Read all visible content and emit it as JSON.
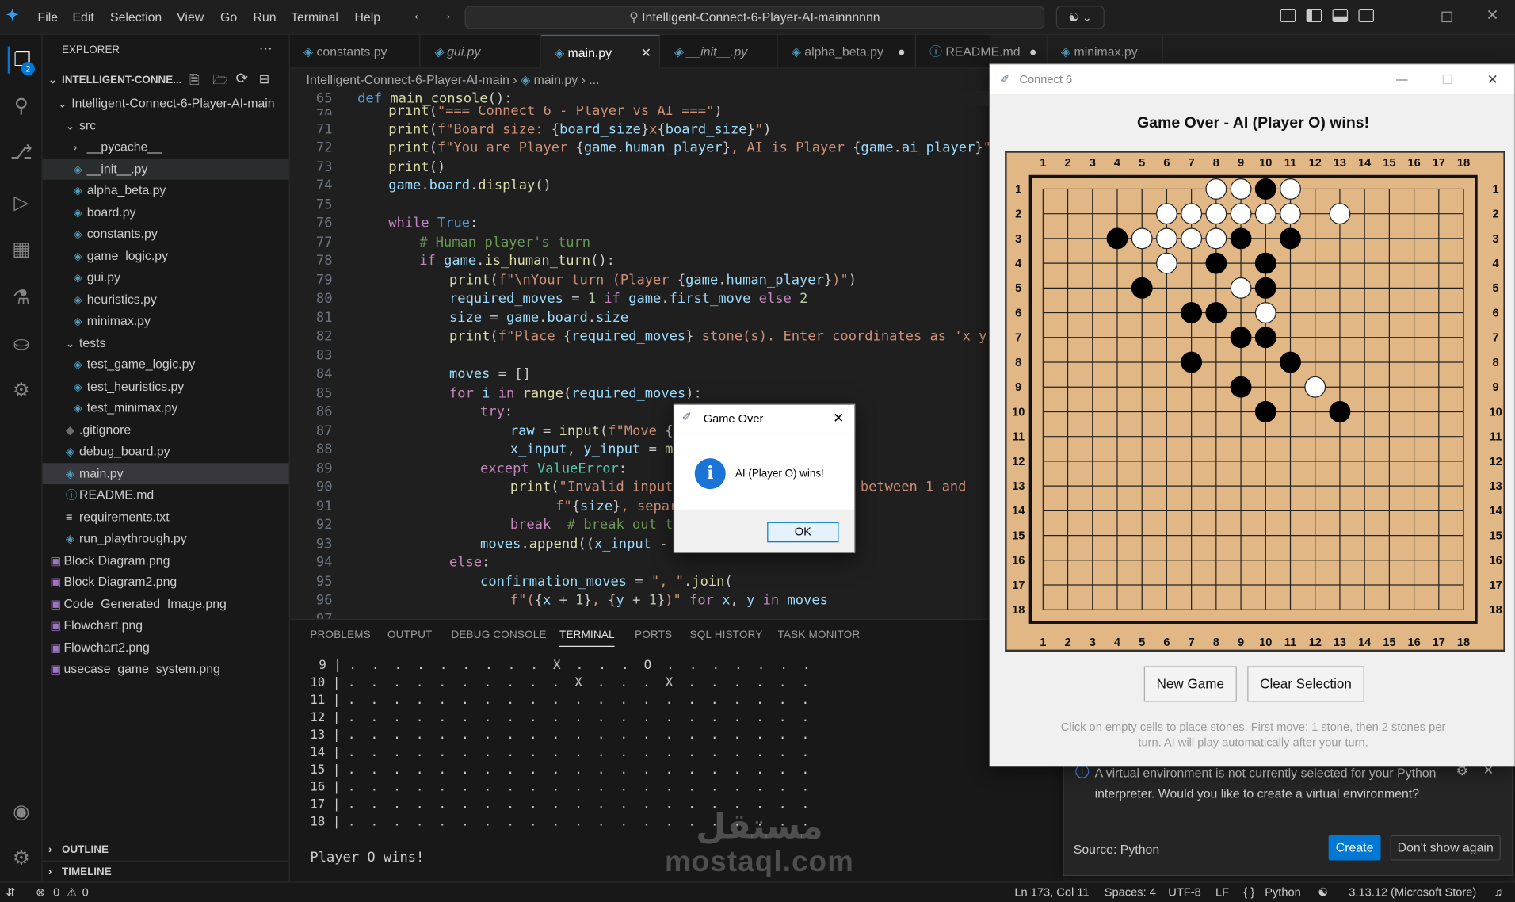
{
  "menu": [
    "File",
    "Edit",
    "Selection",
    "View",
    "Go",
    "Run",
    "Terminal",
    "Help"
  ],
  "command_center": "Intelligent-Connect-6-Player-AI-mainnnnnn",
  "explorer": {
    "title": "EXPLORER",
    "root": "INTELLIGENT-CONNE...",
    "items": [
      "Intelligent-Connect-6-Player-AI-main",
      "src",
      "__pycache__",
      "__init__.py",
      "alpha_beta.py",
      "board.py",
      "constants.py",
      "game_logic.py",
      "gui.py",
      "heuristics.py",
      "minimax.py",
      "tests",
      "test_game_logic.py",
      "test_heuristics.py",
      "test_minimax.py",
      ".gitignore",
      "debug_board.py",
      "main.py",
      "README.md",
      "requirements.txt",
      "run_playthrough.py",
      "Block Diagram.png",
      "Block Diagram2.png",
      "Code_Generated_Image.png",
      "Flowchart.png",
      "Flowchart2.png",
      "usecase_game_system.png"
    ],
    "outline": "OUTLINE",
    "timeline": "TIMELINE"
  },
  "tabs": [
    "constants.py",
    "gui.py",
    "main.py",
    "__init__.py",
    "alpha_beta.py",
    "README.md",
    "minimax.py"
  ],
  "breadcrumb": {
    "folder": "Intelligent-Connect-6-Player-AI-main",
    "file": "main.py",
    "rest": "..."
  },
  "code": {
    "line_numbers": [
      "65",
      "70",
      "71",
      "72",
      "73",
      "74",
      "75",
      "76",
      "77",
      "78",
      "79",
      "80",
      "81",
      "82",
      "83",
      "84",
      "85",
      "86",
      "87",
      "88",
      "89",
      "90",
      "91",
      "92",
      "93",
      "94",
      "95",
      "96",
      "97"
    ]
  },
  "panel": {
    "tabs": [
      "PROBLEMS",
      "OUTPUT",
      "DEBUG CONSOLE",
      "TERMINAL",
      "PORTS",
      "SQL HISTORY",
      "TASK MONITOR"
    ],
    "lines": [
      " 9 | .  .  .  .  .  .  .  .  .  X  .  .  .  O  .  .  .  .  .  .  .",
      " 10 | .  .  .  .  .  .  .  .  .  .  X  .  .  .  X  .  .  .  .  .  .",
      " 11 | .  .  .  .  .  .  .  .  .  .  .  .  .  .  .  .  .  .  .  .  .",
      " 12 | .  .  .  .  .  .  .  .  .  .  .  .  .  .  .  .  .  .  .  .  .",
      " 13 | .  .  .  .  .  .  .  .  .  .  .  .  .  .  .  .  .  .  .  .  .",
      " 14 | .  .  .  .  .  .  .  .  .  .  .  .  .  .  .  .  .  .  .  .  .",
      " 15 | .  .  .  .  .  .  .  .  .  .  .  .  .  .  .  .  .  .  .  .  .",
      " 16 | .  .  .  .  .  .  .  .  .  .  .  .  .  .  .  .  .  .  .  .  .",
      " 17 | .  .  .  .  .  .  .  .  .  .  .  .  .  .  .  .  .  .  .  .  .",
      " 18 | .  .  .  .  .  .  .  .  .  .  .  .  .  .  .  .  .  .  .  .  ."
    ],
    "result": "Player O wins!"
  },
  "status": {
    "errors": "0",
    "warnings": "0",
    "position": "Ln 173, Col 11",
    "spaces": "Spaces: 4",
    "encoding": "UTF-8",
    "eol": "LF",
    "language": "Python",
    "interpreter": "3.13.12 (Microsoft Store)"
  },
  "connect6": {
    "window_title": "Connect 6",
    "heading": "Game Over - AI (Player O) wins!",
    "col_labels": [
      "1",
      "2",
      "3",
      "4",
      "5",
      "6",
      "7",
      "8",
      "9",
      "10",
      "11",
      "12",
      "13",
      "14",
      "15",
      "16",
      "17",
      "18"
    ],
    "row_labels": [
      "1",
      "2",
      "3",
      "4",
      "5",
      "6",
      "7",
      "8",
      "9",
      "10",
      "11",
      "12",
      "13",
      "14",
      "15",
      "16",
      "17",
      "18"
    ],
    "black_stones": [
      [
        10,
        1
      ],
      [
        4,
        3
      ],
      [
        9,
        3
      ],
      [
        11,
        3
      ],
      [
        8,
        4
      ],
      [
        10,
        4
      ],
      [
        5,
        5
      ],
      [
        10,
        5
      ],
      [
        7,
        6
      ],
      [
        8,
        6
      ],
      [
        9,
        7
      ],
      [
        10,
        7
      ],
      [
        7,
        8
      ],
      [
        11,
        8
      ],
      [
        9,
        9
      ],
      [
        10,
        10
      ],
      [
        13,
        10
      ]
    ],
    "white_stones": [
      [
        8,
        1
      ],
      [
        9,
        1
      ],
      [
        11,
        1
      ],
      [
        6,
        2
      ],
      [
        7,
        2
      ],
      [
        8,
        2
      ],
      [
        9,
        2
      ],
      [
        10,
        2
      ],
      [
        11,
        2
      ],
      [
        13,
        2
      ],
      [
        5,
        3
      ],
      [
        6,
        3
      ],
      [
        7,
        3
      ],
      [
        8,
        3
      ],
      [
        6,
        4
      ],
      [
        9,
        5
      ],
      [
        10,
        6
      ],
      [
        12,
        9
      ]
    ],
    "new_game_button": "New Game",
    "clear_button": "Clear Selection",
    "hint": "Click on empty cells to place stones. First move: 1 stone, then 2 stones per turn. AI will play automatically after your turn."
  },
  "dialog": {
    "title": "Game Over",
    "message": "AI (Player O) wins!",
    "ok": "OK"
  },
  "notification": {
    "message": "A virtual environment is not currently selected for your Python interpreter. Would you like to create a virtual environment?",
    "source": "Source: Python",
    "create": "Create",
    "dont_show": "Don't show again"
  },
  "watermark": {
    "arabic": "مستقل",
    "latin": "mostaql.com"
  },
  "colors": {
    "accent": "#0078d4",
    "board": "#e2b786"
  }
}
